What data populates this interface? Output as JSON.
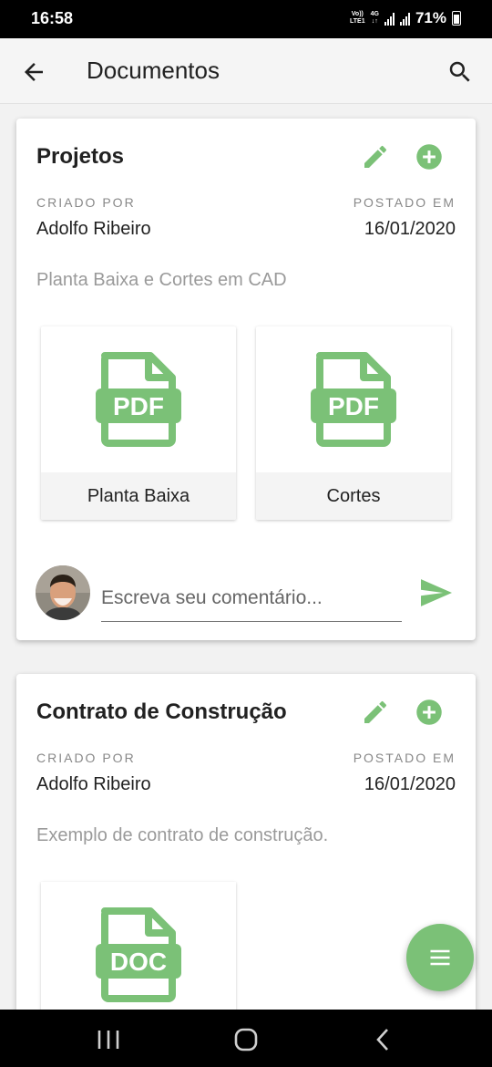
{
  "status_bar": {
    "time": "16:58",
    "network_top": "Vo))",
    "network_bottom": "LTE1",
    "network_type": "4G",
    "battery": "71%"
  },
  "app_bar": {
    "title": "Documentos",
    "back_icon": "arrow-left-icon",
    "search_icon": "search-icon"
  },
  "colors": {
    "accent": "#7bc177",
    "text": "#222222",
    "muted": "#9a9a9a"
  },
  "cards": [
    {
      "title": "Projetos",
      "created_by_label": "CRIADO POR",
      "created_by": "Adolfo Ribeiro",
      "posted_label": "POSTADO EM",
      "posted_date": "16/01/2020",
      "description": "Planta Baixa e Cortes em CAD",
      "files": [
        {
          "type": "PDF",
          "name": "Planta Baixa"
        },
        {
          "type": "PDF",
          "name": "Cortes"
        }
      ],
      "comment_placeholder": "Escreva seu comentário..."
    },
    {
      "title": "Contrato de Construção",
      "created_by_label": "CRIADO POR",
      "created_by": "Adolfo Ribeiro",
      "posted_label": "POSTADO EM",
      "posted_date": "16/01/2020",
      "description": "Exemplo de contrato de construção.",
      "files": [
        {
          "type": "DOC"
        }
      ]
    }
  ],
  "fab": {
    "icon": "menu-icon"
  }
}
